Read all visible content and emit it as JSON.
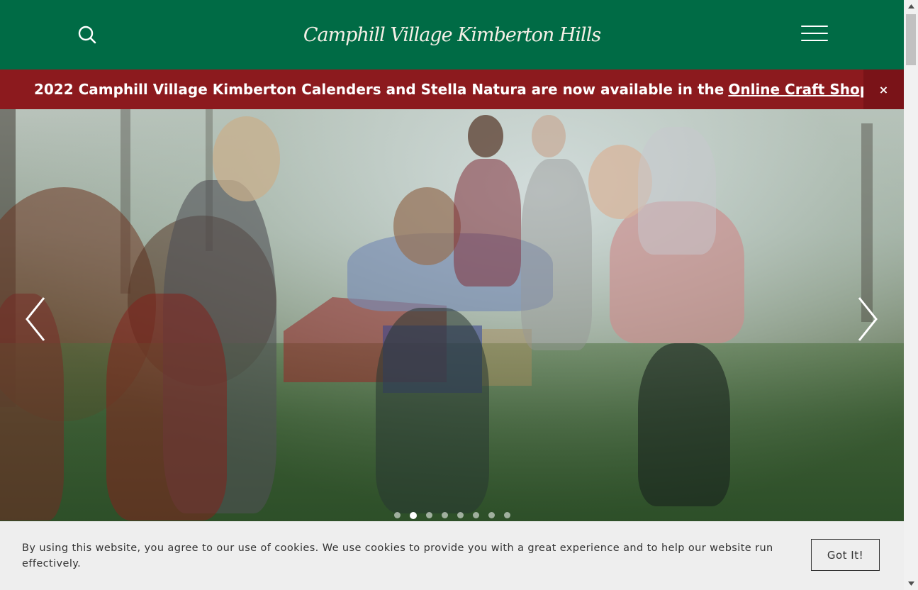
{
  "header": {
    "logo_text": "Camphill Village Kimberton Hills",
    "search_icon": "search-icon",
    "menu_icon": "hamburger-menu-icon",
    "background_color": "#006b45"
  },
  "announcement": {
    "text": "2022 Camphill Village Kimberton Calenders and Stella Natura are now available in the",
    "link_text": "Online Craft Shop",
    "close_label": "×",
    "background_color": "#8c1a1e"
  },
  "hero": {
    "prev_icon": "chevron-left-icon",
    "next_icon": "chevron-right-icon",
    "slide_count": 8,
    "active_slide": 2
  },
  "cookie_banner": {
    "text": "By using this website, you agree to our use of cookies. We use cookies to provide you with a great experience and to help our website run effectively.",
    "button_label": "Got It!"
  }
}
